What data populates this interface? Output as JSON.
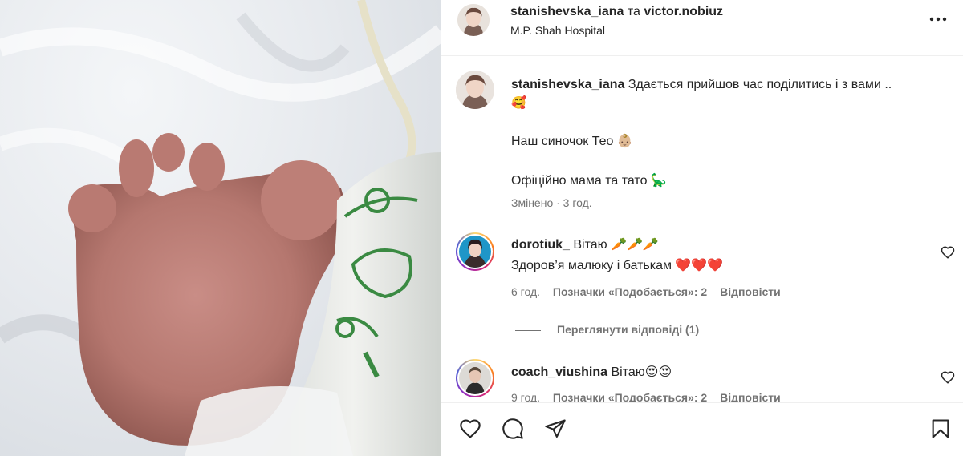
{
  "post": {
    "author": "stanishevska_iana",
    "conjunction": "та",
    "collaborator": "victor.nobiuz",
    "location": "M.P. Shah Hospital"
  },
  "caption": {
    "username": "stanishevska_iana",
    "text": "Здається прийшов час поділитись і з вами ..",
    "emoji1": "🥰",
    "line2": "Наш синочок Тео 👶🏼",
    "line3": "Офіційно мама та тато 🦕",
    "meta": "Змінено · 3 год."
  },
  "comments": [
    {
      "username": "dorotiuk_",
      "text": "Вітаю 🥕🥕🥕",
      "text2": "Здоров’я малюку і батькам ❤️❤️❤️",
      "time": "6 год.",
      "likes": "Позначки «Подобається»: 2",
      "reply": "Відповісти"
    },
    {
      "username": "coach_viushina",
      "text": "Вітаю😍😍",
      "time": "9 год.",
      "likes": "Позначки «Подобається»: 2",
      "reply": "Відповісти"
    }
  ],
  "view_replies": "Переглянути відповіді (1)",
  "icons": {
    "more": "more-horizontal-icon",
    "like": "heart-icon",
    "comment": "comment-icon",
    "share": "share-icon",
    "save": "bookmark-icon"
  },
  "colors": {
    "text": "#262626",
    "secondary": "#737373",
    "heart_red": "#e0102a",
    "tag_green": "#3a8a42"
  }
}
